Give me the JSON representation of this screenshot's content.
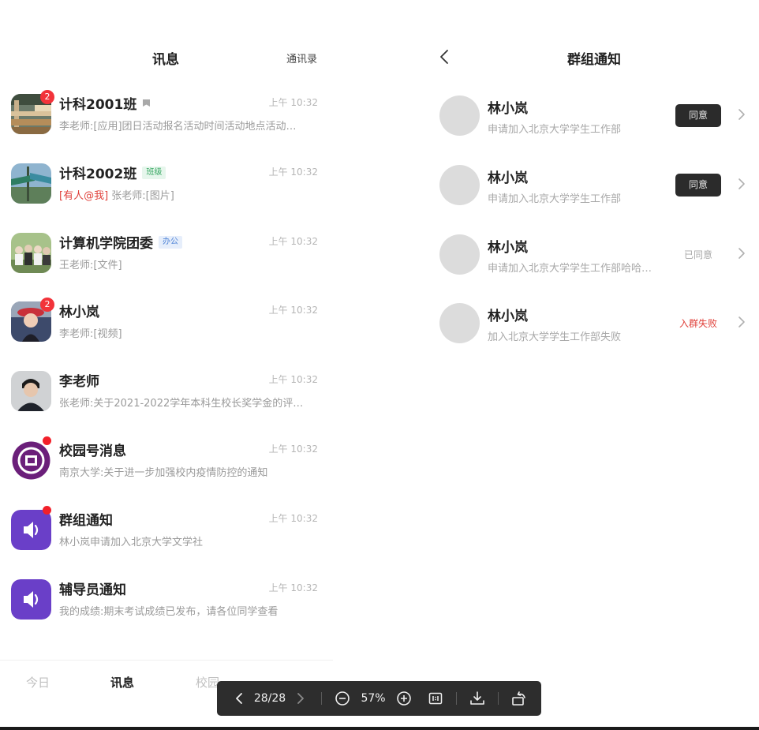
{
  "left": {
    "title": "讯息",
    "contacts_link": "通讯录",
    "conversations": [
      {
        "name": "计科2001班",
        "tag": "",
        "badge": "2",
        "time": "上午 10:32",
        "preview": "李老师:[应用]团日活动报名活动时间活动地点活动…",
        "mention": ""
      },
      {
        "name": "计科2002班",
        "tag": "班级",
        "badge": "",
        "time": "上午 10:32",
        "preview": "张老师:[图片]",
        "mention": "[有人@我]"
      },
      {
        "name": "计算机学院团委",
        "tag": "办公",
        "badge": "",
        "time": "上午 10:32",
        "preview": "王老师:[文件]",
        "mention": ""
      },
      {
        "name": "林小岚",
        "tag": "",
        "badge": "2",
        "time": "上午 10:32",
        "preview": "李老师:[视频]",
        "mention": ""
      },
      {
        "name": "李老师",
        "tag": "",
        "badge": "",
        "time": "上午 10:32",
        "preview": "张老师:关于2021-2022学年本科生校长奖学金的评…",
        "mention": ""
      },
      {
        "name": "校园号消息",
        "tag": "",
        "badge": "",
        "time": "上午 10:32",
        "preview": "南京大学:关于进一步加强校内疫情防控的通知",
        "mention": ""
      },
      {
        "name": "群组通知",
        "tag": "",
        "badge": "",
        "time": "上午 10:32",
        "preview": "林小岚申请加入北京大学文学社",
        "mention": ""
      },
      {
        "name": "辅导员通知",
        "tag": "",
        "badge": "",
        "time": "上午 10:32",
        "preview": "我的成绩:期末考试成绩已发布，请各位同学查看",
        "mention": ""
      }
    ],
    "tabs": [
      "今日",
      "讯息",
      "校园"
    ]
  },
  "right": {
    "title": "群组通知",
    "requests": [
      {
        "name": "林小岚",
        "desc": "申请加入北京大学学生工作部",
        "action": "同意"
      },
      {
        "name": "林小岚",
        "desc": "申请加入北京大学学生工作部",
        "action": "同意"
      },
      {
        "name": "林小岚",
        "desc": "申请加入北京大学学生工作部哈哈…",
        "status": "已同意"
      },
      {
        "name": "林小岚",
        "desc": "加入北京大学学生工作部失败",
        "status": "入群失败"
      }
    ]
  },
  "toolbar": {
    "page": "28/28",
    "zoom": "57%"
  },
  "colors": {
    "badge": "#f2333a",
    "mention": "#e0413b",
    "accent_purple": "#6a3fc8",
    "button_dark": "#2b2b2b"
  }
}
